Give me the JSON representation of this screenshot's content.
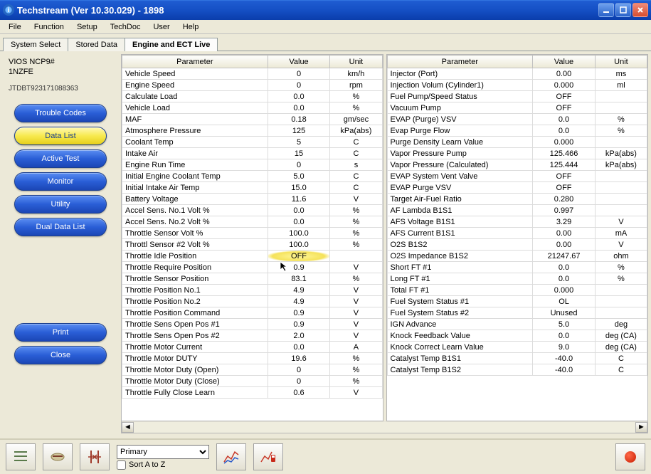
{
  "window": {
    "title": "Techstream (Ver 10.30.029) - 1898"
  },
  "menu": {
    "file": "File",
    "function": "Function",
    "setup": "Setup",
    "techdoc": "TechDoc",
    "user": "User",
    "help": "Help"
  },
  "tabs": {
    "system_select": "System Select",
    "stored_data": "Stored Data",
    "engine_ect": "Engine and ECT Live"
  },
  "vehicle": {
    "model_line1": "VIOS NCP9#",
    "model_line2": "1NZFE",
    "vin": "JTDBT923171088363"
  },
  "side_buttons": {
    "trouble": "Trouble Codes",
    "datalist": "Data List",
    "active": "Active Test",
    "monitor": "Monitor",
    "utility": "Utility",
    "dual": "Dual Data List",
    "print": "Print",
    "close": "Close"
  },
  "table_headers": {
    "parameter": "Parameter",
    "value": "Value",
    "unit": "Unit"
  },
  "left_rows": [
    {
      "p": "Vehicle Speed",
      "v": "0",
      "u": "km/h"
    },
    {
      "p": "Engine Speed",
      "v": "0",
      "u": "rpm"
    },
    {
      "p": "Calculate Load",
      "v": "0.0",
      "u": "%"
    },
    {
      "p": "Vehicle Load",
      "v": "0.0",
      "u": "%"
    },
    {
      "p": "MAF",
      "v": "0.18",
      "u": "gm/sec"
    },
    {
      "p": "Atmosphere Pressure",
      "v": "125",
      "u": "kPa(abs)"
    },
    {
      "p": "Coolant Temp",
      "v": "5",
      "u": "C"
    },
    {
      "p": "Intake Air",
      "v": "15",
      "u": "C"
    },
    {
      "p": "Engine Run Time",
      "v": "0",
      "u": "s"
    },
    {
      "p": "Initial Engine Coolant Temp",
      "v": "5.0",
      "u": "C"
    },
    {
      "p": "Initial Intake Air Temp",
      "v": "15.0",
      "u": "C"
    },
    {
      "p": "Battery Voltage",
      "v": "11.6",
      "u": "V"
    },
    {
      "p": "Accel Sens. No.1 Volt %",
      "v": "0.0",
      "u": "%"
    },
    {
      "p": "Accel Sens. No.2 Volt %",
      "v": "0.0",
      "u": "%"
    },
    {
      "p": "Throttle Sensor Volt %",
      "v": "100.0",
      "u": "%"
    },
    {
      "p": "Throttl Sensor #2 Volt %",
      "v": "100.0",
      "u": "%"
    },
    {
      "p": "Throttle Idle Position",
      "v": "OFF",
      "u": "",
      "hl": true
    },
    {
      "p": "Throttle Require Position",
      "v": "0.9",
      "u": "V"
    },
    {
      "p": "Throttle Sensor Position",
      "v": "83.1",
      "u": "%"
    },
    {
      "p": "Throttle Position No.1",
      "v": "4.9",
      "u": "V"
    },
    {
      "p": "Throttle Position No.2",
      "v": "4.9",
      "u": "V"
    },
    {
      "p": "Throttle Position Command",
      "v": "0.9",
      "u": "V"
    },
    {
      "p": "Throttle Sens Open Pos #1",
      "v": "0.9",
      "u": "V"
    },
    {
      "p": "Throttle Sens Open Pos #2",
      "v": "2.0",
      "u": "V"
    },
    {
      "p": "Throttle Motor Current",
      "v": "0.0",
      "u": "A"
    },
    {
      "p": "Throttle Motor DUTY",
      "v": "19.6",
      "u": "%"
    },
    {
      "p": "Throttle Motor Duty (Open)",
      "v": "0",
      "u": "%"
    },
    {
      "p": "Throttle Motor Duty (Close)",
      "v": "0",
      "u": "%"
    },
    {
      "p": "Throttle Fully Close Learn",
      "v": "0.6",
      "u": "V"
    }
  ],
  "right_rows": [
    {
      "p": "Injector (Port)",
      "v": "0.00",
      "u": "ms"
    },
    {
      "p": "Injection Volum (Cylinder1)",
      "v": "0.000",
      "u": "ml"
    },
    {
      "p": "Fuel Pump/Speed Status",
      "v": "OFF",
      "u": ""
    },
    {
      "p": "Vacuum Pump",
      "v": "OFF",
      "u": ""
    },
    {
      "p": "EVAP (Purge) VSV",
      "v": "0.0",
      "u": "%"
    },
    {
      "p": "Evap Purge Flow",
      "v": "0.0",
      "u": "%"
    },
    {
      "p": "Purge Density Learn Value",
      "v": "0.000",
      "u": ""
    },
    {
      "p": "Vapor Pressure Pump",
      "v": "125.466",
      "u": "kPa(abs)"
    },
    {
      "p": "Vapor Pressure (Calculated)",
      "v": "125.444",
      "u": "kPa(abs)"
    },
    {
      "p": "EVAP System Vent Valve",
      "v": "OFF",
      "u": ""
    },
    {
      "p": "EVAP Purge VSV",
      "v": "OFF",
      "u": ""
    },
    {
      "p": "Target Air-Fuel Ratio",
      "v": "0.280",
      "u": ""
    },
    {
      "p": "AF Lambda B1S1",
      "v": "0.997",
      "u": ""
    },
    {
      "p": "AFS Voltage B1S1",
      "v": "3.29",
      "u": "V"
    },
    {
      "p": "AFS Current B1S1",
      "v": "0.00",
      "u": "mA"
    },
    {
      "p": "O2S B1S2",
      "v": "0.00",
      "u": "V"
    },
    {
      "p": "O2S Impedance B1S2",
      "v": "21247.67",
      "u": "ohm"
    },
    {
      "p": "Short FT #1",
      "v": "0.0",
      "u": "%"
    },
    {
      "p": "Long FT #1",
      "v": "0.0",
      "u": "%"
    },
    {
      "p": "Total FT #1",
      "v": "0.000",
      "u": ""
    },
    {
      "p": "Fuel System Status #1",
      "v": "OL",
      "u": ""
    },
    {
      "p": "Fuel System Status #2",
      "v": "Unused",
      "u": ""
    },
    {
      "p": "IGN Advance",
      "v": "5.0",
      "u": "deg"
    },
    {
      "p": "Knock Feedback Value",
      "v": "0.0",
      "u": "deg (CA)"
    },
    {
      "p": "Knock Correct Learn Value",
      "v": "9.0",
      "u": "deg (CA)"
    },
    {
      "p": "Catalyst Temp B1S1",
      "v": "-40.0",
      "u": "C"
    },
    {
      "p": "Catalyst Temp B1S2",
      "v": "-40.0",
      "u": "C"
    }
  ],
  "footer": {
    "select_value": "Primary",
    "sort_label": "Sort A to Z"
  }
}
